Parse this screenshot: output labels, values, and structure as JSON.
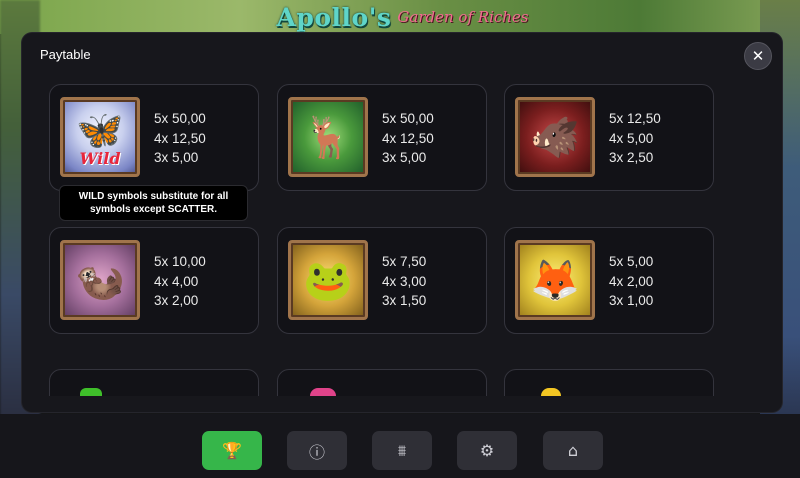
{
  "game": {
    "logo_main": "Apollo's",
    "logo_sub": "Garden of Riches"
  },
  "modal": {
    "title": "Paytable",
    "close_icon": "close-icon"
  },
  "tooltip": {
    "text": "WILD symbols substitute for all symbols except SCATTER."
  },
  "symbols": [
    {
      "name": "wild-butterfly",
      "icon": "butterfly-icon",
      "glyph": "🦋",
      "wild_label": "Wild",
      "pays": [
        "5x 50,00",
        "4x 12,50",
        "3x 5,00"
      ]
    },
    {
      "name": "deer",
      "icon": "deer-icon",
      "glyph": "🦌",
      "pays": [
        "5x 50,00",
        "4x 12,50",
        "3x 5,00"
      ]
    },
    {
      "name": "boar",
      "icon": "boar-icon",
      "glyph": "🐗",
      "pays": [
        "5x 12,50",
        "4x 5,00",
        "3x 2,50"
      ]
    },
    {
      "name": "otter",
      "icon": "otter-icon",
      "glyph": "🦦",
      "pays": [
        "5x 10,00",
        "4x 4,00",
        "3x 2,00"
      ]
    },
    {
      "name": "frog",
      "icon": "frog-icon",
      "glyph": "🐸",
      "pays": [
        "5x 7,50",
        "4x 3,00",
        "3x 1,50"
      ]
    },
    {
      "name": "fox",
      "icon": "fox-icon",
      "glyph": "🦊",
      "pays": [
        "5x 5,00",
        "4x 2,00",
        "3x 1,00"
      ]
    }
  ],
  "nav": [
    {
      "name": "paytable-button",
      "icon": "trophy-icon",
      "glyph": "🏆",
      "active": true
    },
    {
      "name": "info-button",
      "icon": "info-icon",
      "glyph": "ⓘ",
      "active": false
    },
    {
      "name": "paylines-button",
      "icon": "paylines-icon",
      "glyph": "⩩",
      "active": false
    },
    {
      "name": "settings-button",
      "icon": "gear-icon",
      "glyph": "⚙",
      "active": false
    },
    {
      "name": "home-button",
      "icon": "home-icon",
      "glyph": "⌂",
      "active": false
    }
  ],
  "colors": {
    "accent_green": "#36b64a",
    "wild_red": "#e8263b",
    "card_border": "#34343d",
    "frame_gold": "#a0744b"
  }
}
